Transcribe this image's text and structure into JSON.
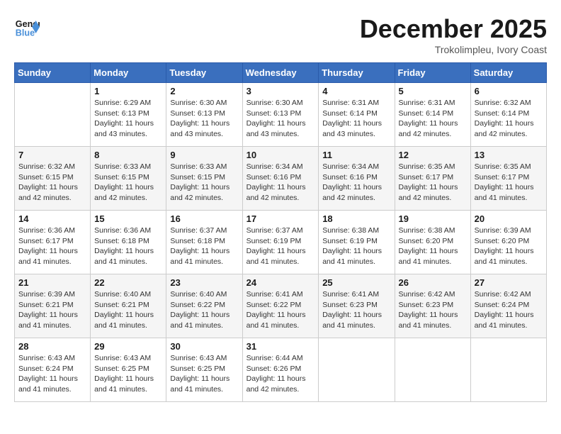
{
  "header": {
    "logo_text_general": "General",
    "logo_text_blue": "Blue",
    "main_title": "December 2025",
    "subtitle": "Trokolimpleu, Ivory Coast"
  },
  "calendar": {
    "days_of_week": [
      "Sunday",
      "Monday",
      "Tuesday",
      "Wednesday",
      "Thursday",
      "Friday",
      "Saturday"
    ],
    "weeks": [
      [
        {
          "day": "",
          "info": ""
        },
        {
          "day": "1",
          "info": "Sunrise: 6:29 AM\nSunset: 6:13 PM\nDaylight: 11 hours\nand 43 minutes."
        },
        {
          "day": "2",
          "info": "Sunrise: 6:30 AM\nSunset: 6:13 PM\nDaylight: 11 hours\nand 43 minutes."
        },
        {
          "day": "3",
          "info": "Sunrise: 6:30 AM\nSunset: 6:13 PM\nDaylight: 11 hours\nand 43 minutes."
        },
        {
          "day": "4",
          "info": "Sunrise: 6:31 AM\nSunset: 6:14 PM\nDaylight: 11 hours\nand 43 minutes."
        },
        {
          "day": "5",
          "info": "Sunrise: 6:31 AM\nSunset: 6:14 PM\nDaylight: 11 hours\nand 42 minutes."
        },
        {
          "day": "6",
          "info": "Sunrise: 6:32 AM\nSunset: 6:14 PM\nDaylight: 11 hours\nand 42 minutes."
        }
      ],
      [
        {
          "day": "7",
          "info": "Sunrise: 6:32 AM\nSunset: 6:15 PM\nDaylight: 11 hours\nand 42 minutes."
        },
        {
          "day": "8",
          "info": "Sunrise: 6:33 AM\nSunset: 6:15 PM\nDaylight: 11 hours\nand 42 minutes."
        },
        {
          "day": "9",
          "info": "Sunrise: 6:33 AM\nSunset: 6:15 PM\nDaylight: 11 hours\nand 42 minutes."
        },
        {
          "day": "10",
          "info": "Sunrise: 6:34 AM\nSunset: 6:16 PM\nDaylight: 11 hours\nand 42 minutes."
        },
        {
          "day": "11",
          "info": "Sunrise: 6:34 AM\nSunset: 6:16 PM\nDaylight: 11 hours\nand 42 minutes."
        },
        {
          "day": "12",
          "info": "Sunrise: 6:35 AM\nSunset: 6:17 PM\nDaylight: 11 hours\nand 42 minutes."
        },
        {
          "day": "13",
          "info": "Sunrise: 6:35 AM\nSunset: 6:17 PM\nDaylight: 11 hours\nand 41 minutes."
        }
      ],
      [
        {
          "day": "14",
          "info": "Sunrise: 6:36 AM\nSunset: 6:17 PM\nDaylight: 11 hours\nand 41 minutes."
        },
        {
          "day": "15",
          "info": "Sunrise: 6:36 AM\nSunset: 6:18 PM\nDaylight: 11 hours\nand 41 minutes."
        },
        {
          "day": "16",
          "info": "Sunrise: 6:37 AM\nSunset: 6:18 PM\nDaylight: 11 hours\nand 41 minutes."
        },
        {
          "day": "17",
          "info": "Sunrise: 6:37 AM\nSunset: 6:19 PM\nDaylight: 11 hours\nand 41 minutes."
        },
        {
          "day": "18",
          "info": "Sunrise: 6:38 AM\nSunset: 6:19 PM\nDaylight: 11 hours\nand 41 minutes."
        },
        {
          "day": "19",
          "info": "Sunrise: 6:38 AM\nSunset: 6:20 PM\nDaylight: 11 hours\nand 41 minutes."
        },
        {
          "day": "20",
          "info": "Sunrise: 6:39 AM\nSunset: 6:20 PM\nDaylight: 11 hours\nand 41 minutes."
        }
      ],
      [
        {
          "day": "21",
          "info": "Sunrise: 6:39 AM\nSunset: 6:21 PM\nDaylight: 11 hours\nand 41 minutes."
        },
        {
          "day": "22",
          "info": "Sunrise: 6:40 AM\nSunset: 6:21 PM\nDaylight: 11 hours\nand 41 minutes."
        },
        {
          "day": "23",
          "info": "Sunrise: 6:40 AM\nSunset: 6:22 PM\nDaylight: 11 hours\nand 41 minutes."
        },
        {
          "day": "24",
          "info": "Sunrise: 6:41 AM\nSunset: 6:22 PM\nDaylight: 11 hours\nand 41 minutes."
        },
        {
          "day": "25",
          "info": "Sunrise: 6:41 AM\nSunset: 6:23 PM\nDaylight: 11 hours\nand 41 minutes."
        },
        {
          "day": "26",
          "info": "Sunrise: 6:42 AM\nSunset: 6:23 PM\nDaylight: 11 hours\nand 41 minutes."
        },
        {
          "day": "27",
          "info": "Sunrise: 6:42 AM\nSunset: 6:24 PM\nDaylight: 11 hours\nand 41 minutes."
        }
      ],
      [
        {
          "day": "28",
          "info": "Sunrise: 6:43 AM\nSunset: 6:24 PM\nDaylight: 11 hours\nand 41 minutes."
        },
        {
          "day": "29",
          "info": "Sunrise: 6:43 AM\nSunset: 6:25 PM\nDaylight: 11 hours\nand 41 minutes."
        },
        {
          "day": "30",
          "info": "Sunrise: 6:43 AM\nSunset: 6:25 PM\nDaylight: 11 hours\nand 41 minutes."
        },
        {
          "day": "31",
          "info": "Sunrise: 6:44 AM\nSunset: 6:26 PM\nDaylight: 11 hours\nand 42 minutes."
        },
        {
          "day": "",
          "info": ""
        },
        {
          "day": "",
          "info": ""
        },
        {
          "day": "",
          "info": ""
        }
      ]
    ]
  }
}
